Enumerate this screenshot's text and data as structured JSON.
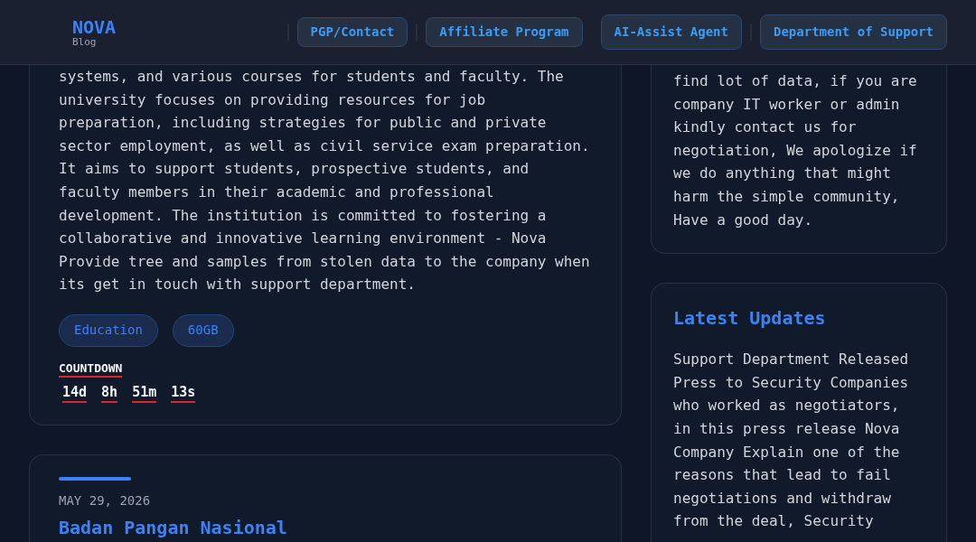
{
  "header": {
    "logo": "NOVA",
    "logo_subtitle": "Blog",
    "nav": [
      {
        "label": "PGP/Contact",
        "kind": "link",
        "divider_before": true
      },
      {
        "label": "Affiliate Program",
        "kind": "link",
        "divider_before": true
      },
      {
        "label": "AI-Assist Agent",
        "kind": "button",
        "divider_before": false
      },
      {
        "label": "Department of Support",
        "kind": "button",
        "divider_before": true
      }
    ]
  },
  "posts": [
    {
      "excerpt": "systems, and various courses for students and faculty. The university focuses on providing resources for job preparation, including strategies for public and private sector employment, as well as civil service exam preparation. It aims to support students, prospective students, and faculty members in their academic and professional development. The institution is committed to fostering a collaborative and innovative learning environment - Nova Provide tree and samples from stolen data to the company when its get in touch with support department.",
      "tags": [
        "Education",
        "60GB"
      ],
      "countdown": {
        "label": "COUNTDOWN",
        "units": [
          "14d",
          "8h",
          "51m",
          "13s"
        ]
      }
    },
    {
      "date": "MAY 29, 2026",
      "title": "Badan Pangan Nasional"
    }
  ],
  "sidebar": [
    {
      "text": "find lot of data, if you are company IT worker or admin kindly contact us for negotiation, We apologize if we do anything that might harm the simple community, Have a good day."
    },
    {
      "title": "Latest Updates",
      "text": "Support Department Released Press to Security Companies who worked as negotiators, in this press release Nova Company Explain one of the reasons that lead to fail negotiations and withdraw from the deal, Security"
    }
  ]
}
